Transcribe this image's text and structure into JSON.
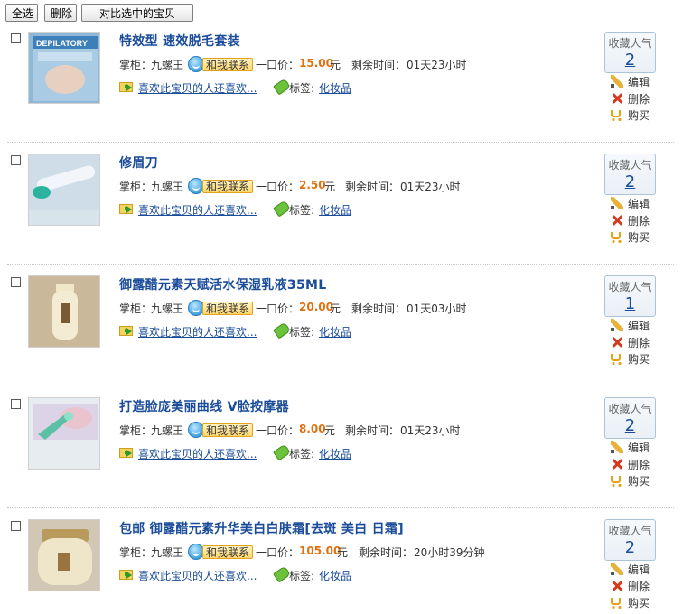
{
  "toolbar": {
    "select_all": "全选",
    "delete": "删除",
    "compare": "对比选中的宝贝"
  },
  "labels": {
    "seller_prefix": "掌柜：",
    "contact": "和我联系",
    "price_prefix": "一口价：",
    "currency": "元",
    "remaining_prefix": "剩余时间：",
    "related": "喜欢此宝贝的人还喜欢...",
    "tag_prefix": "标签:",
    "fav_label": "收藏人气",
    "edit": "编辑",
    "delete": "删除",
    "buy": "购买"
  },
  "items": [
    {
      "title": "特效型 速效脱毛套装",
      "seller": "九螺王",
      "price": "15.00",
      "remaining": "01天23小时",
      "tag": "化妆品",
      "favorites": "2"
    },
    {
      "title": "修眉刀",
      "seller": "九螺王",
      "price": "2.50",
      "remaining": "01天23小时",
      "tag": "化妆品",
      "favorites": "2"
    },
    {
      "title": "御露醋元素天赋活水保湿乳液35ML",
      "seller": "九螺王",
      "price": "20.00",
      "remaining": "01天03小时",
      "tag": "化妆品",
      "favorites": "1"
    },
    {
      "title": "打造脸庞美丽曲线 V脸按摩器",
      "seller": "九螺王",
      "price": "8.00",
      "remaining": "01天23小时",
      "tag": "化妆品",
      "favorites": "2"
    },
    {
      "title": "包邮 御露醋元素升华美白白肤霜[去斑 美白 日霜]",
      "seller": "九螺王",
      "price": "105.00",
      "remaining": "20小时39分钟",
      "tag": "化妆品",
      "favorites": "2"
    }
  ],
  "thumbnail_texts": {
    "item0": "DEPILATORY"
  },
  "colors": {
    "link": "#1a4c9a",
    "price": "#e07010"
  }
}
